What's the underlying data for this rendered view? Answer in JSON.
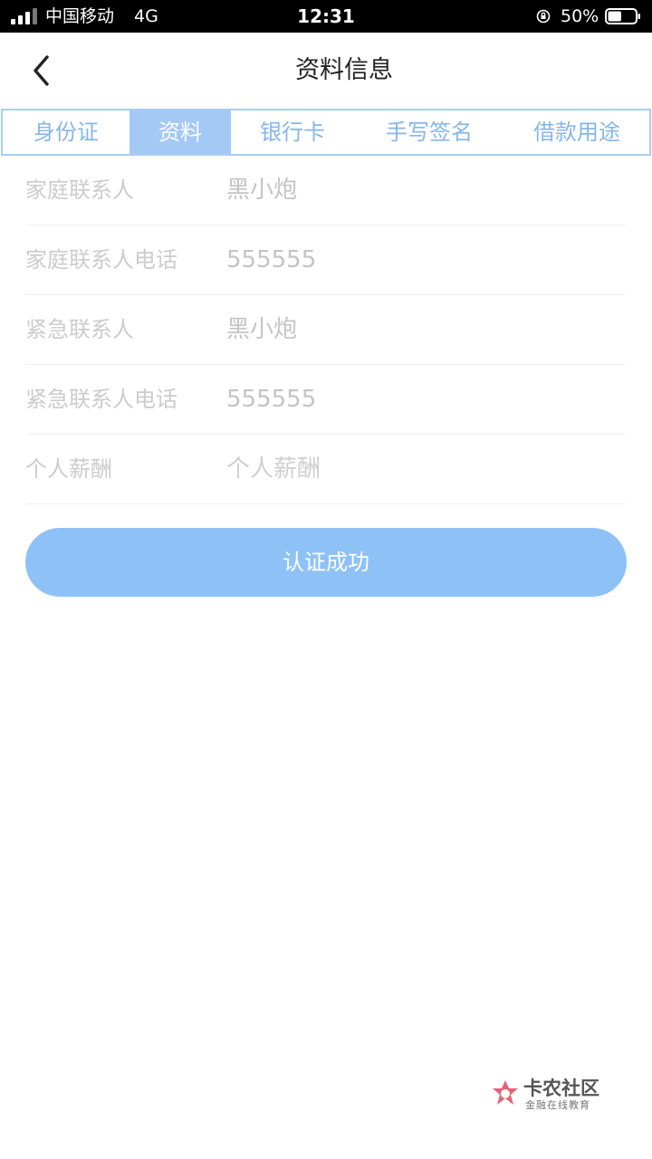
{
  "status_bar": {
    "carrier": "中国移动",
    "network": "4G",
    "time": "12:31",
    "battery_percent": "50%",
    "battery_level": 0.5
  },
  "nav": {
    "title": "资料信息",
    "back_icon": "chevron-left-icon"
  },
  "tabs": [
    {
      "label": "身份证",
      "active": false
    },
    {
      "label": "资料",
      "active": true
    },
    {
      "label": "银行卡",
      "active": false
    },
    {
      "label": "手写签名",
      "active": false
    },
    {
      "label": "借款用途",
      "active": false
    }
  ],
  "form": {
    "rows": [
      {
        "label": "家庭联系人",
        "value": "黑小炮"
      },
      {
        "label": "家庭联系人电话",
        "value": "555555"
      },
      {
        "label": "紧急联系人",
        "value": "黑小炮"
      },
      {
        "label": "紧急联系人电话",
        "value": "555555"
      },
      {
        "label": "个人薪酬",
        "placeholder": "个人薪酬"
      }
    ]
  },
  "submit": {
    "label": "认证成功"
  },
  "watermark": {
    "title": "卡农社区",
    "subtitle": "金融在线教育"
  },
  "colors": {
    "accent": "#8ec2f7",
    "tab_active_bg": "#a4c9f4",
    "tab_border": "#a9cdf2",
    "tab_text": "#86b6eb",
    "muted_text": "#cccccc"
  }
}
